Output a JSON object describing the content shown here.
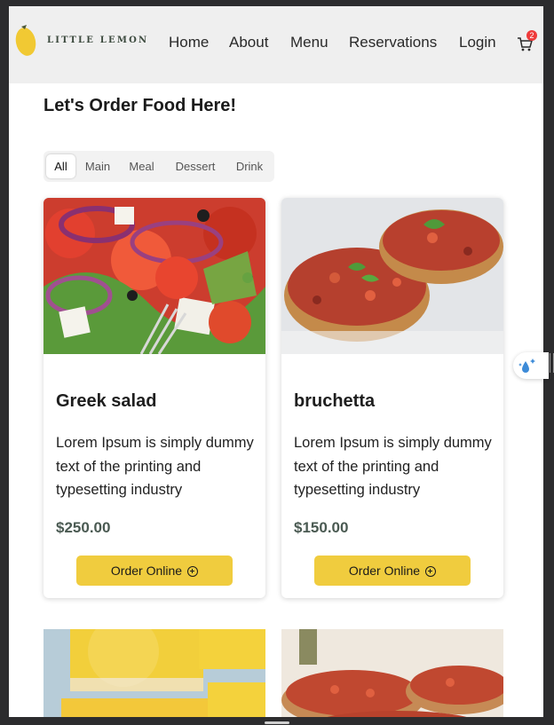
{
  "brand": {
    "name": "LITTLE LEMON",
    "logo_icon": "lemon-icon",
    "accent": "#f0cc3e"
  },
  "nav": {
    "links": [
      "Home",
      "About",
      "Menu",
      "Reservations",
      "Login"
    ],
    "cart_icon": "cart-icon",
    "cart_count": "2"
  },
  "page_title": "Let's Order Food Here!",
  "tabs": {
    "items": [
      "All",
      "Main",
      "Meal",
      "Dessert",
      "Drink"
    ],
    "active": "All"
  },
  "cards": [
    {
      "title": "Greek salad",
      "desc": "Lorem Ipsum is simply dummy text of the printing and typesetting industry",
      "price": "$250.00",
      "button": "Order Online"
    },
    {
      "title": "bruchetta",
      "desc": "Lorem Ipsum is simply dummy text of the printing and typesetting industry",
      "price": "$150.00",
      "button": "Order Online"
    }
  ],
  "floating_widget_icon": "sparkle-drop-icon"
}
